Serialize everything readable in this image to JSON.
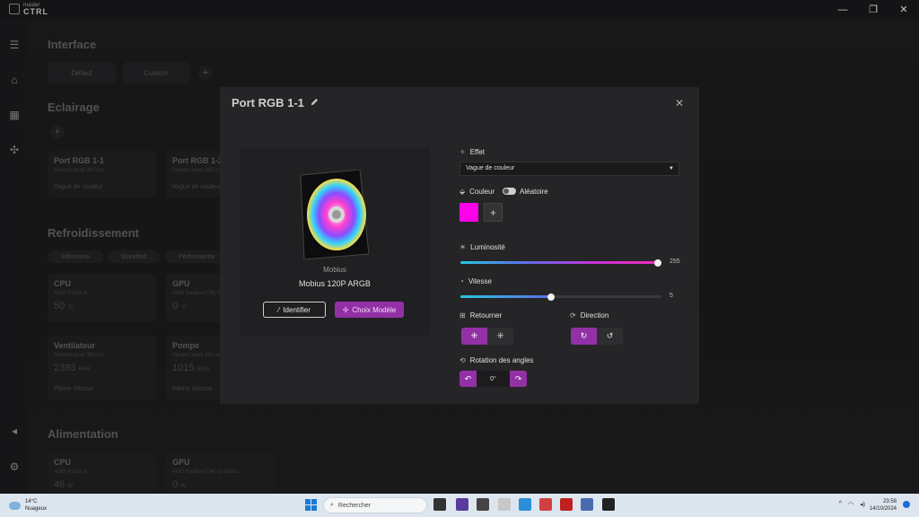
{
  "app": {
    "brand_small": "master",
    "brand_big": "CTRL"
  },
  "window_controls": {
    "minimize": "—",
    "maximize": "❐",
    "close": "✕"
  },
  "background": {
    "interface": {
      "title": "Interface",
      "buttons": [
        "Défaut",
        "Custom"
      ],
      "add": "+"
    },
    "lighting": {
      "title": "Eclairage",
      "add": "+",
      "cards": [
        {
          "title": "Port RGB 1-1",
          "subtitle": "MasterLiquid 360 Ion",
          "footer": "Vague de couleur"
        },
        {
          "title": "Port RGB 1-2",
          "subtitle": "MasterLiquid 360 Ion",
          "footer": "Vague de couleur"
        }
      ]
    },
    "cooling": {
      "title": "Refroidissement",
      "modes": [
        "Silencieux",
        "Standard",
        "Performance"
      ],
      "cards": [
        {
          "title": "CPU",
          "subtitle": "AMD Ryzen 9",
          "value": "50",
          "unit": "°C"
        },
        {
          "title": "GPU",
          "subtitle": "AMD Radeon(TM) Graphics",
          "value": "0",
          "unit": "°C"
        },
        {
          "title": "Ventilateur",
          "subtitle": "MasterLiquid 360 Ion",
          "value": "2393",
          "unit": "RPM",
          "footer": "Pleine Vitesse"
        },
        {
          "title": "Pompe",
          "subtitle": "MasterLiquid 360 Ion",
          "value": "1015",
          "unit": "RPM",
          "footer": "Pleine Vitesse"
        }
      ]
    },
    "power": {
      "title": "Alimentation",
      "cards": [
        {
          "title": "CPU",
          "subtitle": "AMD Ryzen 9",
          "value": "46",
          "unit": "W"
        },
        {
          "title": "GPU",
          "subtitle": "AMD Radeon(TM) Graphics",
          "value": "0",
          "unit": "W"
        }
      ]
    }
  },
  "modal": {
    "title": "Port RGB 1-1",
    "close": "✕",
    "device": {
      "brand": "Mobius",
      "model": "Mobius 120P ARGB"
    },
    "buttons": {
      "identify": "Identifier",
      "choose_model": "Choix Modèle"
    },
    "effect": {
      "label": "Effet",
      "value": "Vague de couleur"
    },
    "color": {
      "label": "Couleur",
      "random_label": "Aléatoire",
      "random_on": false,
      "swatch": "#ff00ea",
      "add": "+"
    },
    "brightness": {
      "label": "Luminosité",
      "value": "255",
      "fraction": 1.0
    },
    "speed": {
      "label": "Vitesse",
      "value": "5",
      "fraction": 0.45
    },
    "flip": {
      "label": "Retourner",
      "options": [
        "⁜",
        "⁜"
      ]
    },
    "direction": {
      "label": "Direction",
      "options": [
        "↻",
        "↺"
      ]
    },
    "rotation": {
      "label": "Rotation des angles",
      "value": "0°",
      "left": "↶",
      "right": "↷"
    }
  },
  "taskbar": {
    "weather": {
      "temp": "14°C",
      "condition": "Nuageux"
    },
    "search_placeholder": "Rechercher",
    "time": "23:58",
    "date": "14/10/2024"
  },
  "colors": {
    "accent": "#9330a6",
    "swatch": "#ff00ea"
  }
}
